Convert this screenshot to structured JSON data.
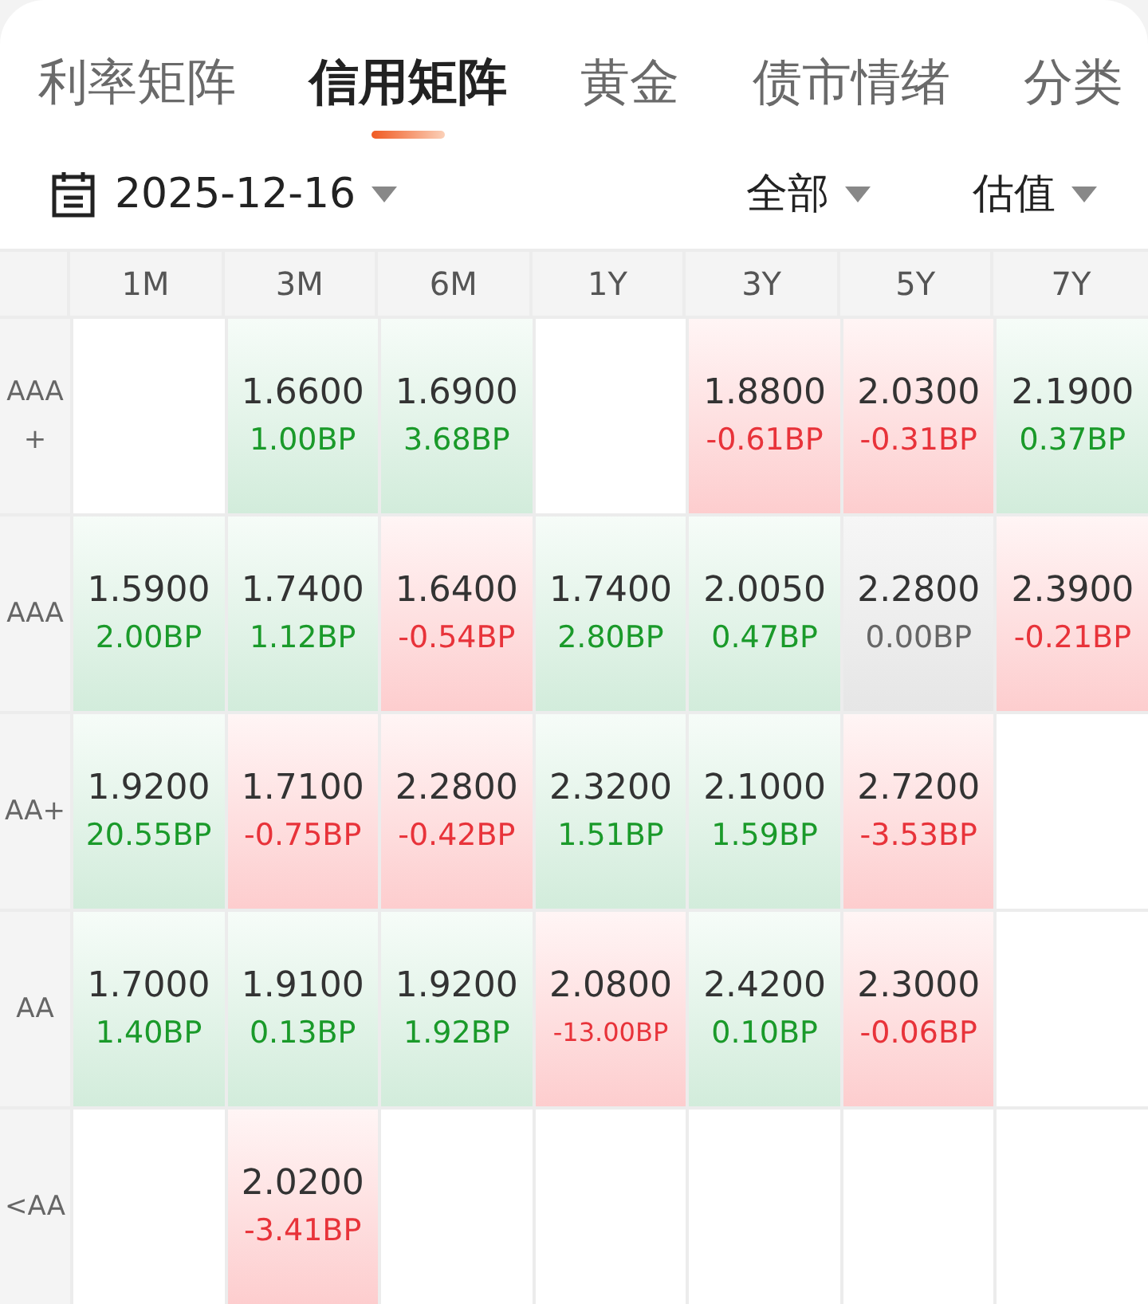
{
  "tabs": [
    {
      "label": "利率矩阵",
      "selected": false
    },
    {
      "label": "信用矩阵",
      "selected": true
    },
    {
      "label": "黄金",
      "selected": false
    },
    {
      "label": "债市情绪",
      "selected": false
    },
    {
      "label": "分类",
      "selected": false
    }
  ],
  "filters": {
    "date": "2025-12-16",
    "scope": "全部",
    "measure": "估值"
  },
  "table": {
    "columns": [
      "1M",
      "3M",
      "6M",
      "1Y",
      "3Y",
      "5Y",
      "7Y"
    ],
    "rows": [
      {
        "label": "AAA+",
        "cells": [
          {
            "kind": "empty"
          },
          {
            "kind": "up",
            "value": "1.6600",
            "change": "1.00BP"
          },
          {
            "kind": "up",
            "value": "1.6900",
            "change": "3.68BP"
          },
          {
            "kind": "empty"
          },
          {
            "kind": "down",
            "value": "1.8800",
            "change": "-0.61BP"
          },
          {
            "kind": "down",
            "value": "2.0300",
            "change": "-0.31BP"
          },
          {
            "kind": "up",
            "value": "2.1900",
            "change": "0.37BP"
          }
        ]
      },
      {
        "label": "AAA",
        "cells": [
          {
            "kind": "up",
            "value": "1.5900",
            "change": "2.00BP"
          },
          {
            "kind": "up",
            "value": "1.7400",
            "change": "1.12BP"
          },
          {
            "kind": "down",
            "value": "1.6400",
            "change": "-0.54BP"
          },
          {
            "kind": "up",
            "value": "1.7400",
            "change": "2.80BP"
          },
          {
            "kind": "up",
            "value": "2.0050",
            "change": "0.47BP"
          },
          {
            "kind": "flat",
            "value": "2.2800",
            "change": "0.00BP"
          },
          {
            "kind": "down",
            "value": "2.3900",
            "change": "-0.21BP"
          }
        ]
      },
      {
        "label": "AA+",
        "cells": [
          {
            "kind": "up",
            "value": "1.9200",
            "change": "20.55BP"
          },
          {
            "kind": "down",
            "value": "1.7100",
            "change": "-0.75BP"
          },
          {
            "kind": "down",
            "value": "2.2800",
            "change": "-0.42BP"
          },
          {
            "kind": "up",
            "value": "2.3200",
            "change": "1.51BP"
          },
          {
            "kind": "up",
            "value": "2.1000",
            "change": "1.59BP"
          },
          {
            "kind": "down",
            "value": "2.7200",
            "change": "-3.53BP"
          },
          {
            "kind": "empty"
          }
        ]
      },
      {
        "label": "AA",
        "cells": [
          {
            "kind": "up",
            "value": "1.7000",
            "change": "1.40BP"
          },
          {
            "kind": "up",
            "value": "1.9100",
            "change": "0.13BP"
          },
          {
            "kind": "up",
            "value": "1.9200",
            "change": "1.92BP"
          },
          {
            "kind": "down",
            "value": "2.0800",
            "change": "-13.00BP"
          },
          {
            "kind": "up",
            "value": "2.4200",
            "change": "0.10BP"
          },
          {
            "kind": "down",
            "value": "2.3000",
            "change": "-0.06BP"
          },
          {
            "kind": "empty"
          }
        ]
      },
      {
        "label": "<AA",
        "cells": [
          {
            "kind": "empty"
          },
          {
            "kind": "down",
            "value": "2.0200",
            "change": "-3.41BP"
          },
          {
            "kind": "empty"
          },
          {
            "kind": "empty"
          },
          {
            "kind": "empty"
          },
          {
            "kind": "empty"
          },
          {
            "kind": "empty"
          }
        ]
      }
    ]
  }
}
